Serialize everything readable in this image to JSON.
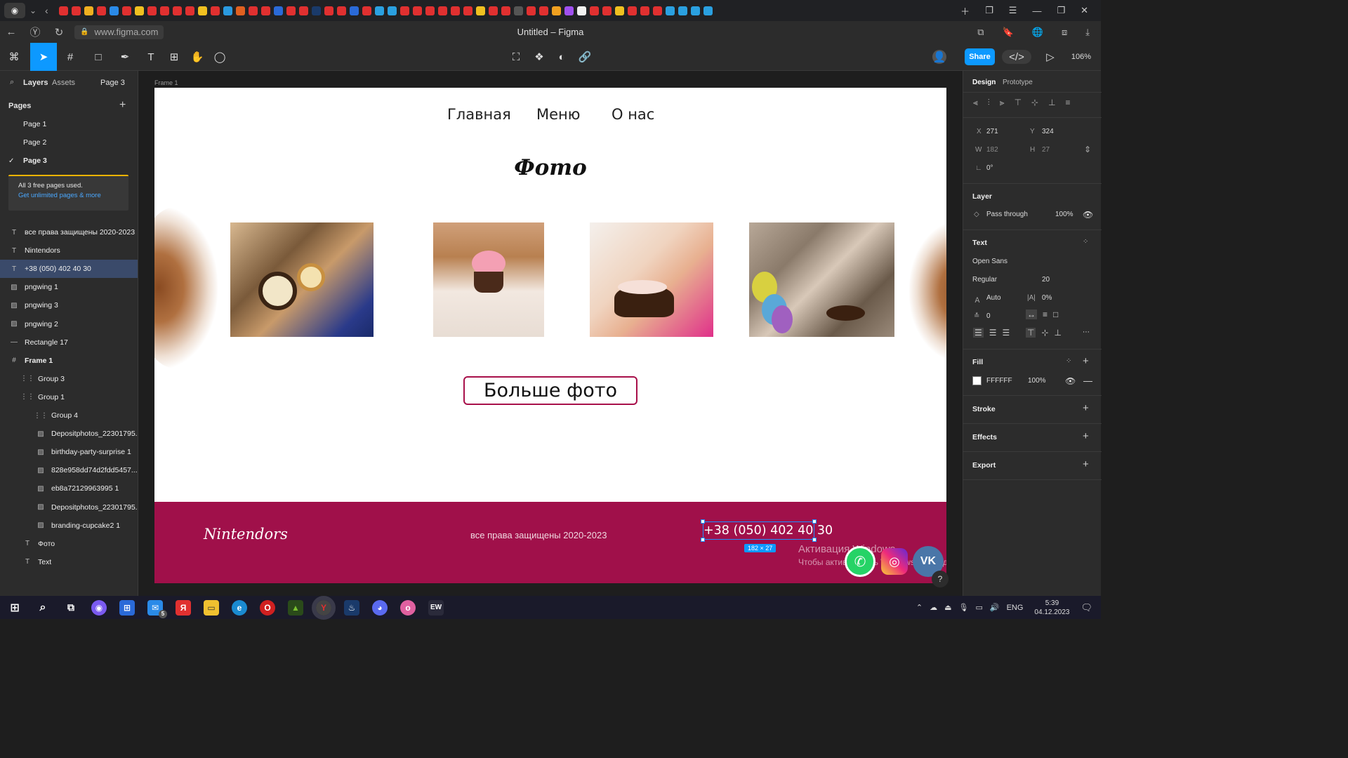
{
  "browser": {
    "url": "www.figma.com",
    "window_title": "Untitled – Figma"
  },
  "toolbar": {
    "share_label": "Share",
    "zoom": "106%"
  },
  "left_panel": {
    "tabs": [
      "Layers",
      "Assets"
    ],
    "current_page": "Page 3",
    "pages_heading": "Pages",
    "pages": [
      "Page 1",
      "Page 2",
      "Page 3"
    ],
    "notice_line1": "All 3 free pages used.",
    "notice_link": "Get unlimited pages & more",
    "layers": [
      {
        "name": "все права защищены 2020-2023",
        "type": "text"
      },
      {
        "name": "Nintendors",
        "type": "text"
      },
      {
        "name": "+38 (050) 402 40 30",
        "type": "text",
        "selected": true
      },
      {
        "name": "pngwing 1",
        "type": "image"
      },
      {
        "name": "pngwing 3",
        "type": "image"
      },
      {
        "name": "pngwing 2",
        "type": "image"
      },
      {
        "name": "Rectangle 17",
        "type": "rect"
      },
      {
        "name": "Frame 1",
        "type": "frame"
      },
      {
        "name": "Group 3",
        "type": "group"
      },
      {
        "name": "Group 1",
        "type": "group"
      },
      {
        "name": "Group 4",
        "type": "group"
      },
      {
        "name": "Depositphotos_22301795...",
        "type": "image"
      },
      {
        "name": "birthday-party-surprise 1",
        "type": "image"
      },
      {
        "name": "828e958dd74d2fdd5457...",
        "type": "image"
      },
      {
        "name": "eb8a72129963995 1",
        "type": "image"
      },
      {
        "name": "Depositphotos_22301795...",
        "type": "image"
      },
      {
        "name": "branding-cupcake2 1",
        "type": "image"
      },
      {
        "name": "Фото",
        "type": "text"
      },
      {
        "name": "Text",
        "type": "text"
      }
    ]
  },
  "canvas": {
    "frame_label": "Frame 1",
    "nav": [
      "Главная",
      "Меню",
      "О нас"
    ],
    "title": "Фото",
    "more_button": "Больше фото",
    "footer_brand": "Nintendors",
    "footer_copyright": "все права защищены 2020-2023",
    "footer_phone": "+38 (050) 402 40 30",
    "selection_size": "182 × 27",
    "activation_title": "Активация Windows",
    "activation_text": "Чтобы активировать Windows, перейдите в раздел \"Параметры\"."
  },
  "right_panel": {
    "tabs": [
      "Design",
      "Prototype"
    ],
    "x_label": "X",
    "x_value": "271",
    "y_label": "Y",
    "y_value": "324",
    "w_label": "W",
    "w_value": "182",
    "h_label": "H",
    "h_value": "27",
    "rotation": "0°",
    "layer_heading": "Layer",
    "blend_mode": "Pass through",
    "opacity": "100%",
    "text_heading": "Text",
    "font_family": "Open Sans",
    "font_weight": "Regular",
    "font_size": "20",
    "line_height": "Auto",
    "letter_spacing": "0%",
    "paragraph_spacing": "0",
    "fill_heading": "Fill",
    "fill_hex": "FFFFFF",
    "fill_opacity": "100%",
    "stroke_heading": "Stroke",
    "effects_heading": "Effects",
    "export_heading": "Export"
  },
  "taskbar": {
    "lang": "ENG",
    "time": "5:39",
    "date": "04.12.2023",
    "mail_badge": "5"
  },
  "colors": {
    "accent": "#0d99ff",
    "footer": "#a0104a",
    "warning": "#f5b400"
  }
}
